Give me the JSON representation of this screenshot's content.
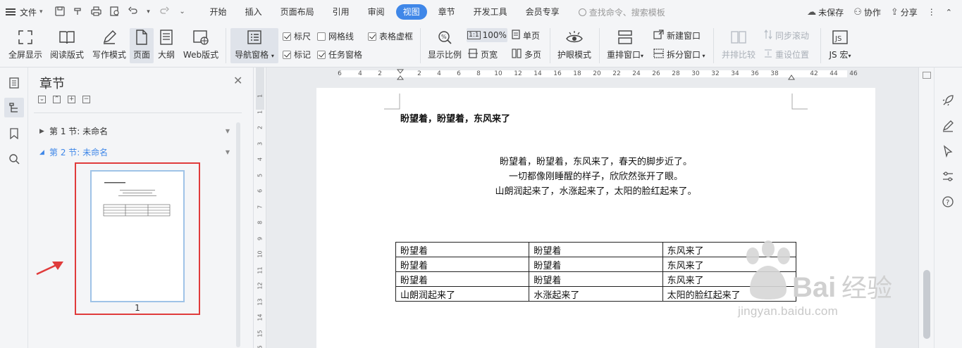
{
  "menubar": {
    "file_label": "文件",
    "tabs": [
      "开始",
      "插入",
      "页面布局",
      "引用",
      "审阅",
      "视图",
      "章节",
      "开发工具",
      "会员专享"
    ],
    "active_tab": "视图",
    "search_placeholder": "查找命令、搜索模板",
    "unsaved": "未保存",
    "collaborate": "协作",
    "share": "分享"
  },
  "ribbon": {
    "fullscreen": "全屏显示",
    "reading": "阅读版式",
    "writing": "写作模式",
    "page": "页面",
    "outline": "大纲",
    "web": "Web版式",
    "nav_pane": "导航窗格",
    "ruler": "标尺",
    "gridlines": "网格线",
    "table_gridlines": "表格虚框",
    "marks": "标记",
    "task_pane": "任务窗格",
    "zoom": "显示比例",
    "zoom_100": "100%",
    "single_page": "单页",
    "page_width": "页宽",
    "multi_page": "多页",
    "eye_mode": "护眼模式",
    "rearrange": "重排窗口",
    "new_window": "新建窗口",
    "split_window": "拆分窗口",
    "side_by_side": "并排比较",
    "sync_scroll": "同步滚动",
    "reset_position": "重设位置",
    "js_macro": "JS 宏",
    "checks": {
      "ruler": true,
      "gridlines": false,
      "table_gridlines": true,
      "marks": true,
      "task_pane": true
    }
  },
  "chapter": {
    "title": "章节",
    "sections": [
      "第 1 节: 未命名",
      "第 2 节: 未命名"
    ],
    "selected_section": 1,
    "page_number": "1"
  },
  "rulers": {
    "h_ticks": [
      "6",
      "4",
      "2",
      "2",
      "4",
      "6",
      "8",
      "10",
      "12",
      "14",
      "16",
      "18",
      "20",
      "22",
      "24",
      "26",
      "28",
      "30",
      "32",
      "34",
      "36",
      "38",
      "42",
      "44",
      "46"
    ],
    "v_ticks": [
      "1",
      "1",
      "2",
      "3",
      "4",
      "5",
      "6",
      "7",
      "8",
      "9",
      "10",
      "11",
      "12",
      "13",
      "14",
      "15",
      "16"
    ]
  },
  "document": {
    "heading": "盼望着，盼望着，东风来了",
    "poem": [
      "盼望着，盼望着，东风来了，春天的脚步近了。",
      "一切都像刚睡醒的样子，欣欣然张开了眼。",
      "山朗润起来了，水涨起来了，太阳的脸红起来了。"
    ],
    "table": [
      [
        "盼望着",
        "盼望着",
        "东风来了"
      ],
      [
        "盼望着",
        "盼望着",
        "东风来了"
      ],
      [
        "盼望着",
        "盼望着",
        "东风来了"
      ],
      [
        "山朗润起来了",
        "水涨起来了",
        "太阳的脸红起来了"
      ]
    ]
  },
  "watermark": {
    "text": "jingyan.baidu.com"
  },
  "colors": {
    "accent": "#3f87e8",
    "highlight_frame": "#e03b3b",
    "arrow": "#e03b3b"
  }
}
